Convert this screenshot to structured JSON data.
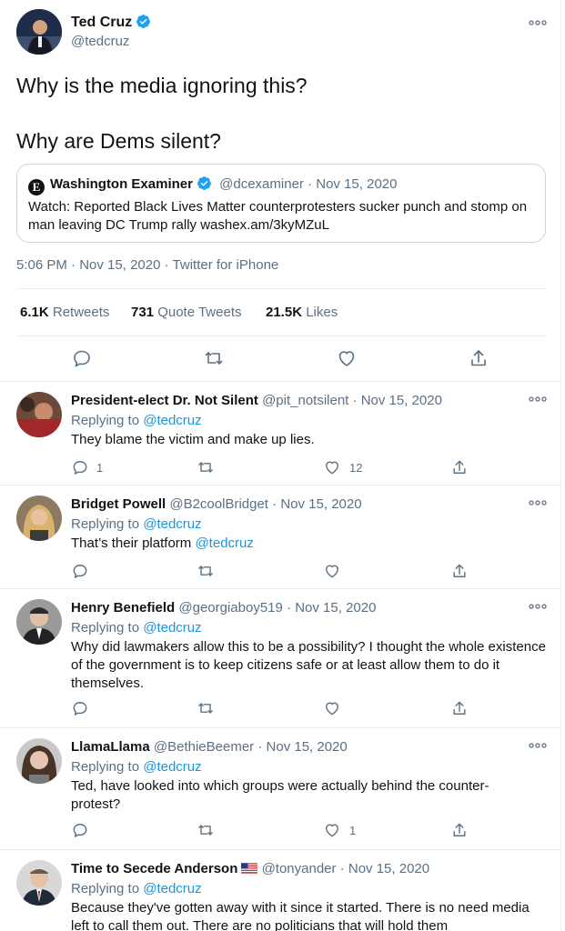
{
  "main_tweet": {
    "name": "Ted Cruz",
    "handle": "@tedcruz",
    "text_line1": "Why is the media ignoring this?",
    "text_line2": "Why are Dems silent?",
    "quoted": {
      "name": "Washington Examiner",
      "handle": "@dcexaminer",
      "date": "Nov 15, 2020",
      "text": "Watch: Reported Black Lives Matter counterprotesters sucker punch and stomp on man leaving DC Trump rally washex.am/3kyMZuL"
    },
    "time": "5:06 PM",
    "date": "Nov 15, 2020",
    "source": "Twitter for iPhone",
    "stats": {
      "retweets_num": "6.1K",
      "retweets_label": "Retweets",
      "quotes_num": "731",
      "quotes_label": "Quote Tweets",
      "likes_num": "21.5K",
      "likes_label": "Likes"
    }
  },
  "replying_to_label": "Replying to",
  "replies": [
    {
      "name": "President-elect Dr. Not Silent",
      "handle": "@pit_notsilent",
      "date": "Nov 15, 2020",
      "replying_to": "@tedcruz",
      "text": "They blame the victim and make up lies.",
      "reply_count": "1",
      "retweet_count": "",
      "like_count": "12"
    },
    {
      "name": "Bridget Powell",
      "handle": "@B2coolBridget",
      "date": "Nov 15, 2020",
      "replying_to": "@tedcruz",
      "text": "That’s their platform",
      "mention": "@tedcruz",
      "reply_count": "",
      "retweet_count": "",
      "like_count": ""
    },
    {
      "name": "Henry Benefield",
      "handle": "@georgiaboy519",
      "date": "Nov 15, 2020",
      "replying_to": "@tedcruz",
      "text": "Why did lawmakers allow this to be a possibility? I thought the whole existence of the government is to keep citizens safe or at least allow them to do it themselves.",
      "reply_count": "",
      "retweet_count": "",
      "like_count": ""
    },
    {
      "name": "LlamaLlama",
      "handle": "@BethieBeemer",
      "date": "Nov 15, 2020",
      "replying_to": "@tedcruz",
      "text": "Ted, have looked into which groups were actually behind the counter-protest?",
      "reply_count": "",
      "retweet_count": "",
      "like_count": "1"
    },
    {
      "name": "Time to Secede Anderson",
      "handle": "@tonyander",
      "date": "Nov 15, 2020",
      "replying_to": "@tedcruz",
      "text": "Because they've gotten away with it since it started. There is no need media left to call them out. There are no politicians that will hold them"
    }
  ],
  "colors": {
    "accent": "#1b95e0",
    "secondary_text": "#5b7083",
    "border": "#e6ecf0"
  }
}
